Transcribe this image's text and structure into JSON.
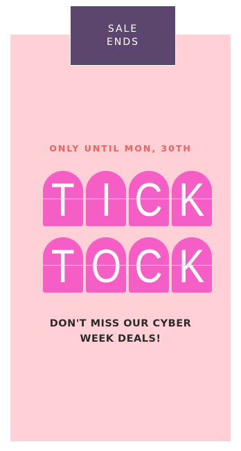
{
  "tag": {
    "line1": "SALE",
    "line2": "ENDS"
  },
  "subtitle": "ONLY UNTIL MON, 30TH",
  "headline": {
    "row1": [
      "T",
      "I",
      "C",
      "K"
    ],
    "row2": [
      "T",
      "O",
      "C",
      "K"
    ]
  },
  "cta": {
    "line1": "DON'T MISS OUR CYBER",
    "line2": "WEEK DEALS!"
  },
  "colors": {
    "card_background": "#ffd0d6",
    "tag_background": "#5c466e",
    "tile": "#f55fc5",
    "subtitle": "#f45f5f",
    "cta_text": "#2b2b2b"
  }
}
